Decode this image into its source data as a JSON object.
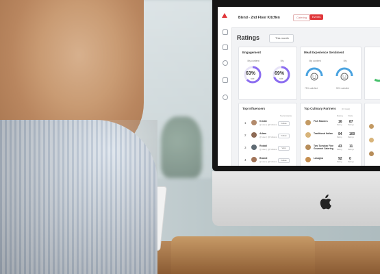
{
  "app": {
    "venue": "Blend - 2nd Floor Kitchen",
    "tabs": [
      "Catering",
      "Events"
    ],
    "page_title": "Ratings",
    "period": "This month"
  },
  "engagement": {
    "title": "Engagement",
    "left_label": "My content",
    "left_pct": "63%",
    "left_sub": "rate",
    "right_label": "My",
    "right_pct": "69%",
    "right_sub": "rate"
  },
  "sentiment": {
    "title": "Meal Experience Sentiment",
    "left_label": "My content",
    "left_sub": "75% satisfied",
    "right_label": "My",
    "right_sub": "55% satisfied"
  },
  "influencers": {
    "title": "Top Influencers",
    "head": "Social status",
    "rows": [
      {
        "rank": "1",
        "name": "Kristie",
        "meta": "@ user | @ follows",
        "btn": "Follow"
      },
      {
        "rank": "2",
        "name": "Adam",
        "meta": "@ user | @ follows",
        "btn": "Follow"
      },
      {
        "rank": "3",
        "name": "Rodali",
        "meta": "@ user | @ follows",
        "btn": "View"
      },
      {
        "rank": "4",
        "name": "Brandi",
        "meta": "@ user | @ follows",
        "btn": "Follow"
      }
    ]
  },
  "partners": {
    "title": "Top Culinary Partners",
    "subtitle": "(15 total)",
    "head1": "Rating",
    "head2": "Visits",
    "rows": [
      {
        "name": "Fish Masters",
        "n1": "16",
        "l1": "Rating",
        "n2": "87",
        "l2": "Ratings"
      },
      {
        "name": "Traditional Italian",
        "n1": "94",
        "l1": "Rating",
        "n2": "100",
        "l2": "Ratings"
      },
      {
        "name": "Two Tuesday Fine Gourmet Catering",
        "n1": "43",
        "l1": "Rating",
        "n2": "11",
        "l2": "Ratings"
      },
      {
        "name": "Lasagna",
        "n1": "92",
        "l1": "Rating",
        "n2": "0",
        "l2": "Ratings"
      }
    ]
  },
  "colors": {
    "accent_red": "#e0373a",
    "gauge_purple": "#8b6cf0",
    "gauge_blue": "#4aa3e0"
  }
}
